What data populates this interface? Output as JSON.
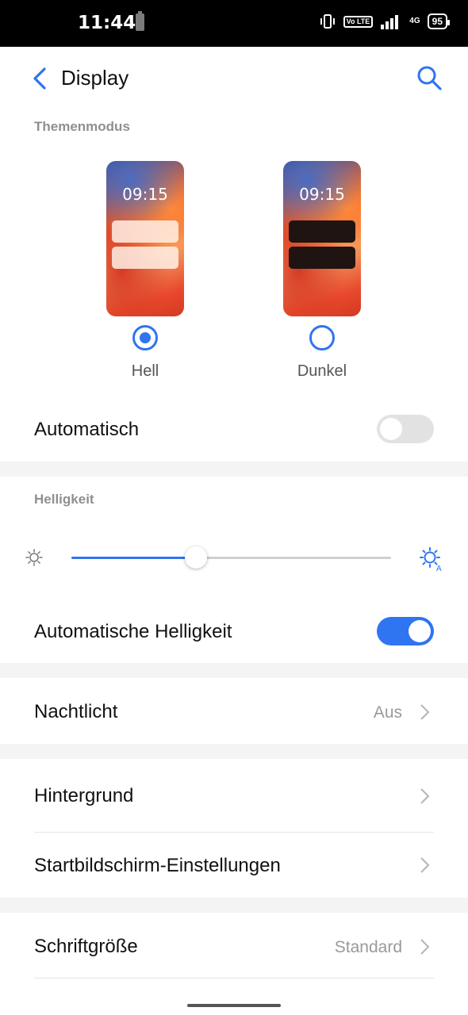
{
  "status_bar": {
    "time": "11:44",
    "volte": "Vo LTE",
    "network": "4G",
    "battery": "95"
  },
  "header": {
    "title": "Display",
    "back_icon": "chevron-left-icon",
    "search_icon": "search-icon"
  },
  "theme_mode": {
    "section_label": "Themenmodus",
    "options": [
      {
        "label": "Hell",
        "preview_time": "09:15",
        "selected": true
      },
      {
        "label": "Dunkel",
        "preview_time": "09:15",
        "selected": false
      }
    ],
    "auto_label": "Automatisch",
    "auto_enabled": false
  },
  "brightness": {
    "section_label": "Helligkeit",
    "level": 0.39,
    "auto_label": "Automatische Helligkeit",
    "auto_enabled": true
  },
  "items": {
    "night_light": {
      "label": "Nachtlicht",
      "value": "Aus"
    },
    "wallpaper": {
      "label": "Hintergrund"
    },
    "home_settings": {
      "label": "Startbildschirm-Einstellungen"
    },
    "font_size": {
      "label": "Schriftgröße",
      "value": "Standard"
    }
  },
  "colors": {
    "accent": "#2f74f0",
    "separator": "#f4f4f4"
  }
}
